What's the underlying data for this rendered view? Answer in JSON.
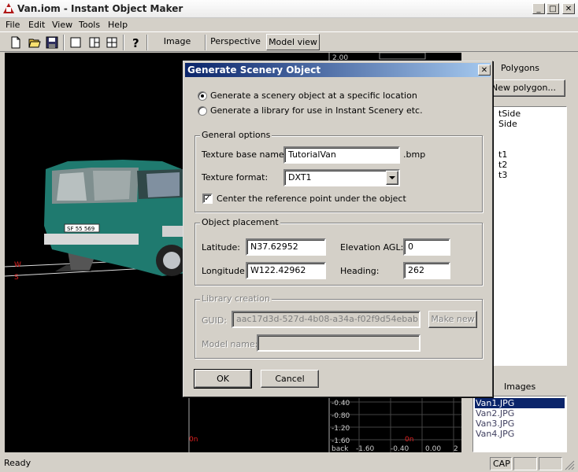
{
  "window": {
    "title": "Van.iom - Instant Object Maker",
    "minimize": "_",
    "maximize": "□",
    "close": "✕"
  },
  "menu": [
    "File",
    "Edit",
    "View",
    "Tools",
    "Help"
  ],
  "toolbar": {
    "tabs": [
      "Image",
      "Perspective",
      "Model view"
    ],
    "active_tab": "Model view"
  },
  "viewport": {
    "ruler_top": "2.00",
    "labels": {
      "w": "W",
      "s": "S",
      "on_left": "0n",
      "on_right": "0n"
    },
    "grid_y": [
      "-0.40",
      "-0.80",
      "-1.20",
      "-1.60"
    ],
    "grid_x": [
      "back",
      "-1.60",
      "-0.40",
      "0.00",
      "2"
    ],
    "plate": "SF 55 569"
  },
  "right_panel": {
    "polygons_label": "Polygons",
    "new_polygon_button": "New polygon...",
    "polygons": [
      "tSide",
      "Side",
      "",
      "",
      "t1",
      "t2",
      "t3"
    ],
    "images_label": "Images",
    "images": [
      "Van1.JPG",
      "Van2.JPG",
      "Van3.JPG",
      "Van4.JPG"
    ],
    "selected_image": "Van1.JPG"
  },
  "status": {
    "text": "Ready",
    "cap": "CAP"
  },
  "dialog": {
    "title": "Generate Scenery Object",
    "close": "✕",
    "radio1": "Generate a scenery object at a specific location",
    "radio2": "Generate a library for use in Instant Scenery etc.",
    "general_options": {
      "title": "General options",
      "texture_base_name_label": "Texture base name:",
      "texture_base_name": "TutorialVan",
      "texture_ext": ".bmp",
      "texture_format_label": "Texture format:",
      "texture_format": "DXT1",
      "center_check_label": "Center the reference point under the object",
      "center_checked": "✓"
    },
    "placement": {
      "title": "Object placement",
      "latitude_label": "Latitude:",
      "latitude": "N37.62952",
      "longitude_label": "Longitude:",
      "longitude": "W122.42962",
      "elevation_label": "Elevation AGL:",
      "elevation": "0",
      "heading_label": "Heading:",
      "heading": "262"
    },
    "library": {
      "title": "Library creation",
      "guid_label": "GUID:",
      "guid": "aac17d3d-527d-4b08-a34a-f02f9d54ebab",
      "make_new_button": "Make new",
      "model_name_label": "Model name:",
      "model_name": ""
    },
    "ok_button": "OK",
    "cancel_button": "Cancel"
  }
}
